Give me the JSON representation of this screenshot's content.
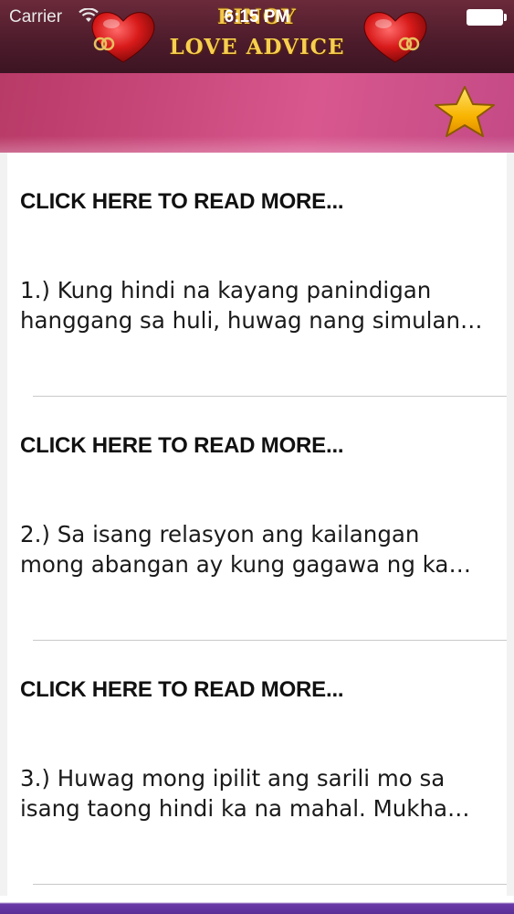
{
  "status_bar": {
    "carrier": "Carrier",
    "time": "6:15 PM"
  },
  "app": {
    "title_line1": "PINOY",
    "title_line2": "LOVE ADVICE"
  },
  "toolbar": {
    "favorite_icon": "star-icon"
  },
  "list": {
    "items": [
      {
        "link_label": "CLICK HERE TO READ MORE...",
        "excerpt": "1.) Kung hindi na kayang panindigan\nhanggang sa huli, huwag nang simulan…"
      },
      {
        "link_label": "CLICK HERE TO READ MORE...",
        "excerpt": "2.) Sa isang relasyon ang kailangan\nmong abangan ay kung gagawa ng ka…"
      },
      {
        "link_label": "CLICK HERE TO READ MORE...",
        "excerpt": "3.) Huwag mong ipilit ang sarili mo sa\nisang taong hindi ka na mahal. Mukha…"
      }
    ]
  },
  "colors": {
    "header_bg": "#4e1c2c",
    "toolbar_accent": "#c8477a",
    "title_gold": "#f4c64b",
    "star_yellow": "#f5b800",
    "bottom_bar": "#5b2e97"
  }
}
